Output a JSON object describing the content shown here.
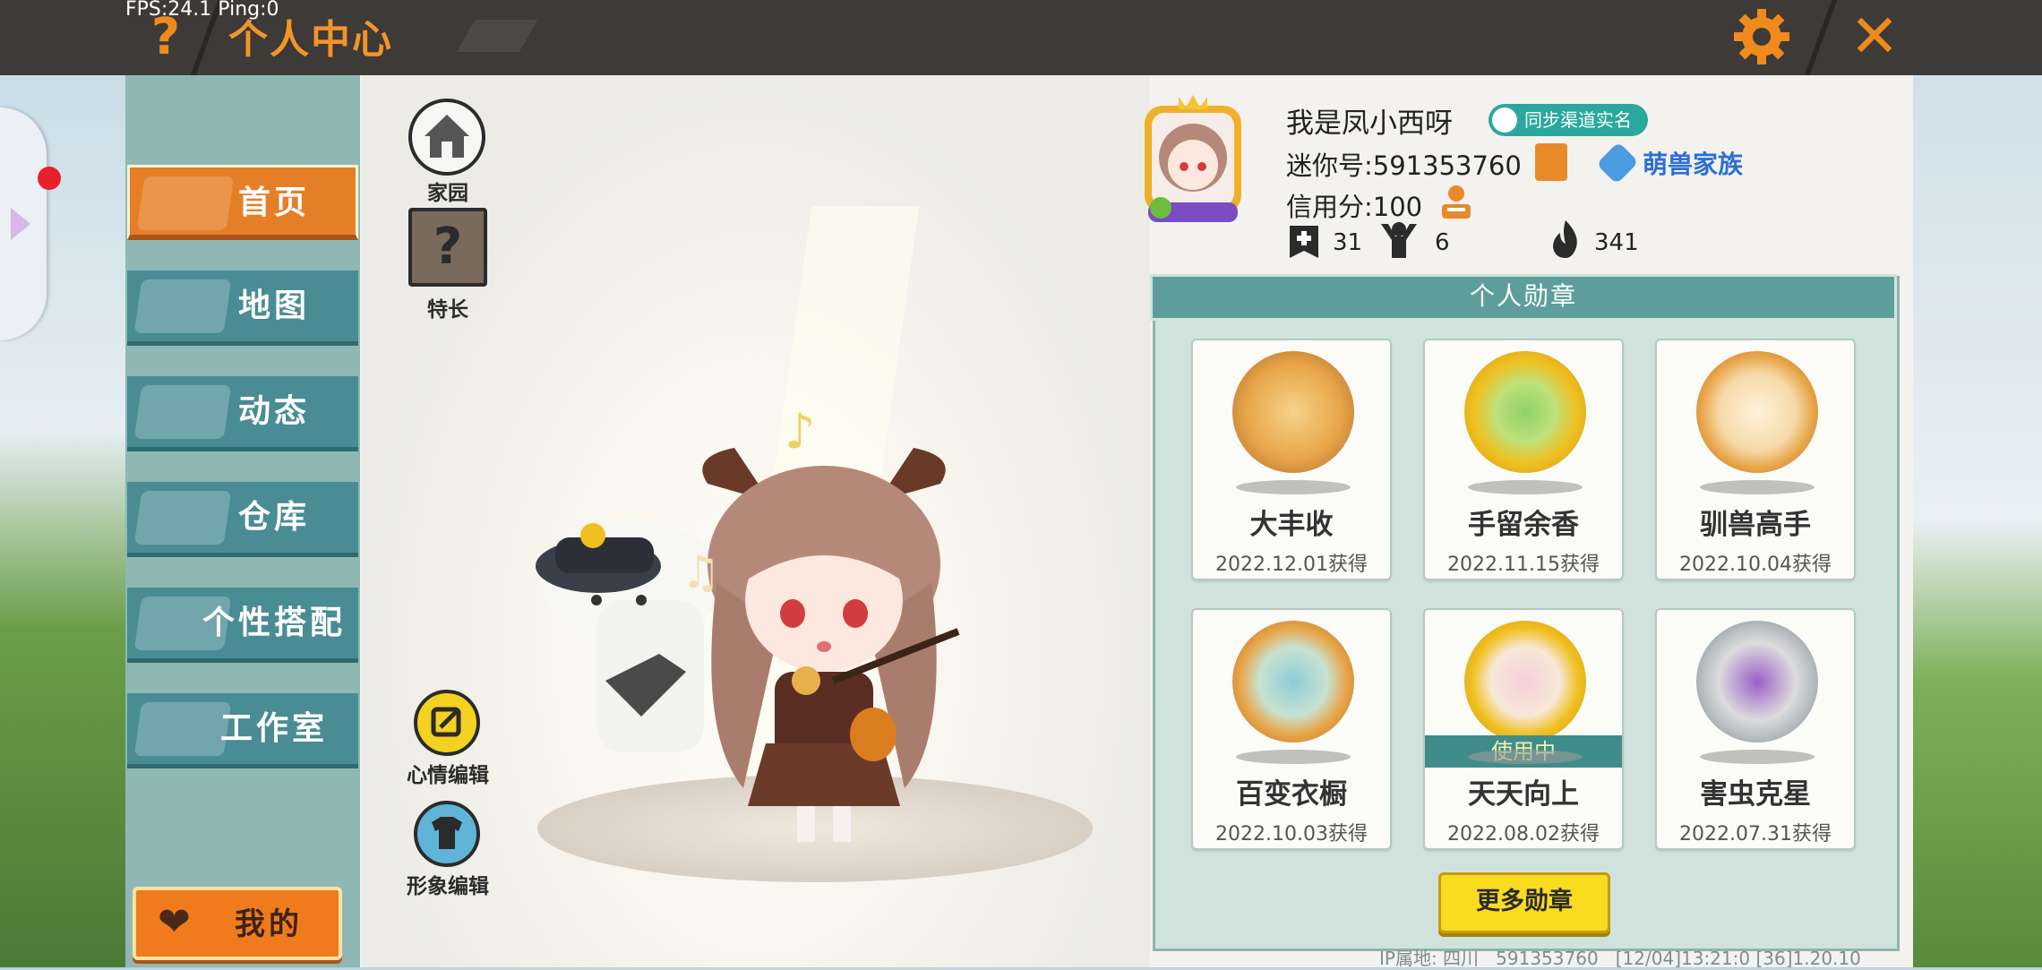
{
  "debug": {
    "fps": "FPS:24.1",
    "ping": "Ping:0"
  },
  "header": {
    "title": "个人中心"
  },
  "nav": {
    "items": [
      {
        "label": "首页",
        "active": true
      },
      {
        "label": "地图",
        "active": false
      },
      {
        "label": "动态",
        "active": false
      },
      {
        "label": "仓库",
        "active": false
      },
      {
        "label": "个性搭配",
        "active": false
      },
      {
        "label": "工作室",
        "active": false
      }
    ],
    "my_label": "我的"
  },
  "stage": {
    "home_label": "家园",
    "skill_label": "特长",
    "mood_label": "心情编辑",
    "avatar_label": "形象编辑"
  },
  "profile": {
    "name": "我是凤小西呀",
    "real_name_badge": "同步渠道实名",
    "mini_id": "迷你号:591353760",
    "family": "萌兽家族",
    "credit": "信用分:100",
    "stats": {
      "adds": "31",
      "fans": "6",
      "fire": "341"
    }
  },
  "medals": {
    "title": "个人勋章",
    "items": [
      {
        "name": "大丰收",
        "date": "2022.12.01获得",
        "color": "#e8a548",
        "in_use": false
      },
      {
        "name": "手留余香",
        "date": "2022.11.15获得",
        "color": "#f0c020",
        "in_use": false
      },
      {
        "name": "驯兽高手",
        "date": "2022.10.04获得",
        "color": "#e8a548",
        "in_use": false
      },
      {
        "name": "百变衣橱",
        "date": "2022.10.03获得",
        "color": "#e8a548",
        "in_use": false
      },
      {
        "name": "天天向上",
        "date": "2022.08.02获得",
        "color": "#f0c020",
        "in_use": true,
        "in_use_label": "使用中"
      },
      {
        "name": "害虫克星",
        "date": "2022.07.31获得",
        "color": "#b7bcc0",
        "in_use": false
      }
    ],
    "more_label": "更多勋章"
  },
  "footer": {
    "ip": "IP属地: 四川",
    "uid": "591353760",
    "time": "[12/04]13:21:0",
    "version": "[36]1.20.10"
  },
  "colors": {
    "accent": "#f08a1c",
    "nav": "#4a8c93",
    "nav_active": "#e47f28",
    "panel_header": "#5d9e9c"
  }
}
